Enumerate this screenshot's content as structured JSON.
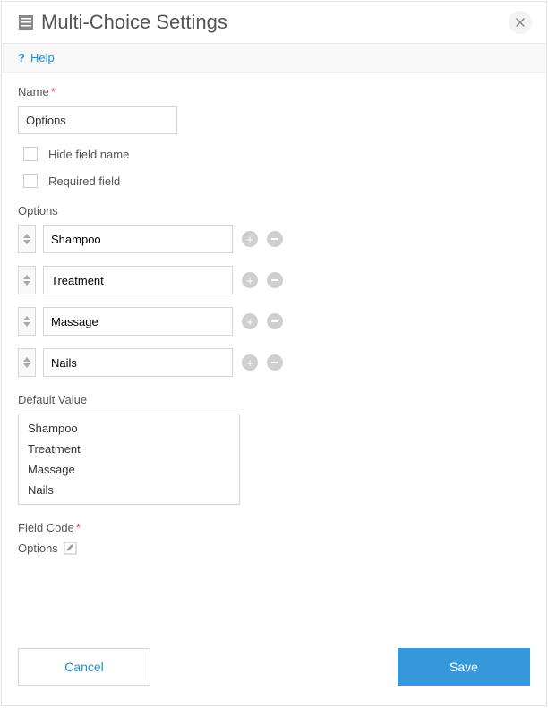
{
  "header": {
    "title": "Multi-Choice Settings"
  },
  "help": {
    "label": "Help"
  },
  "name": {
    "label": "Name",
    "value": "Options",
    "hide_label": "Hide field name",
    "required_label": "Required field"
  },
  "options": {
    "label": "Options",
    "items": [
      {
        "value": "Shampoo"
      },
      {
        "value": "Treatment"
      },
      {
        "value": "Massage"
      },
      {
        "value": "Nails"
      }
    ]
  },
  "default_value": {
    "label": "Default Value",
    "items": [
      "Shampoo",
      "Treatment",
      "Massage",
      "Nails"
    ]
  },
  "field_code": {
    "label": "Field Code",
    "value": "Options"
  },
  "footer": {
    "cancel": "Cancel",
    "save": "Save"
  }
}
